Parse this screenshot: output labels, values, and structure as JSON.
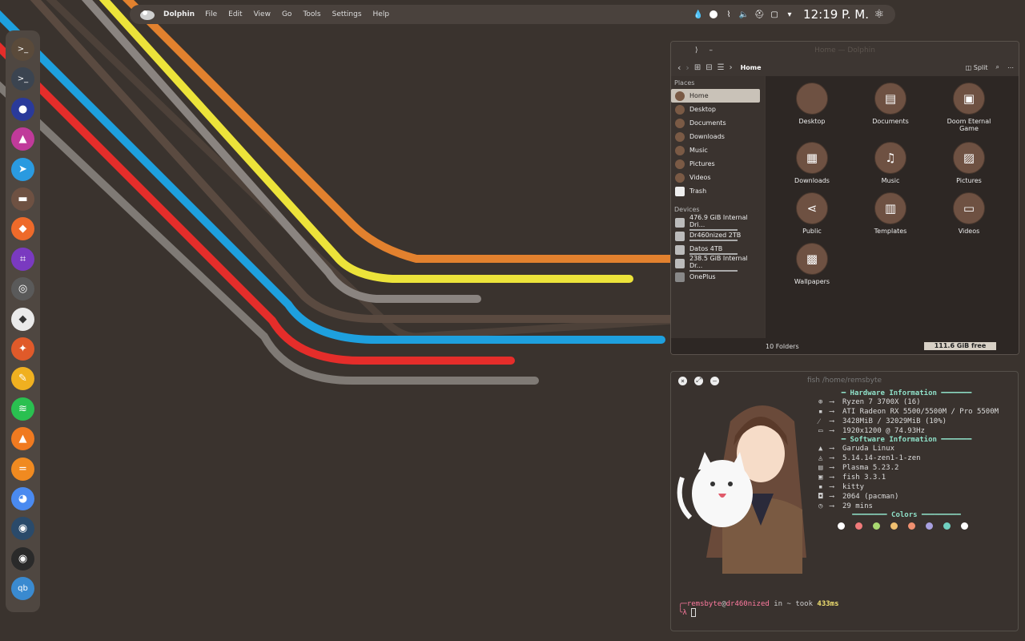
{
  "topbar": {
    "app_name": "Dolphin",
    "menu": [
      "File",
      "Edit",
      "View",
      "Go",
      "Tools",
      "Settings",
      "Help"
    ],
    "clock": "12:19 P. M."
  },
  "dock": {
    "apps": [
      {
        "name": "terminal-app",
        "color": "#5a4a3a",
        "glyph": ">_"
      },
      {
        "name": "konsole-app",
        "color": "#3b4450",
        "glyph": ">_"
      },
      {
        "name": "firefox-app",
        "color": "#2a3a9a",
        "glyph": "●"
      },
      {
        "name": "pamac-app",
        "color": "#c03a9a",
        "glyph": "▲"
      },
      {
        "name": "telegram-app",
        "color": "#2a9ae0",
        "glyph": "➤"
      },
      {
        "name": "notes-app",
        "color": "#6e5142",
        "glyph": "▬"
      },
      {
        "name": "store-app",
        "color": "#ee6a2a",
        "glyph": "◆"
      },
      {
        "name": "crop-app",
        "color": "#7a3ac0",
        "glyph": "⌗"
      },
      {
        "name": "steering-app",
        "color": "#5a5a5a",
        "glyph": "◎"
      },
      {
        "name": "inkscape-app",
        "color": "#eaeaea",
        "glyph": "◆"
      },
      {
        "name": "gimp-app",
        "color": "#e05a2a",
        "glyph": "✦"
      },
      {
        "name": "pencil-app",
        "color": "#f0b020",
        "glyph": "✎"
      },
      {
        "name": "spotify-app",
        "color": "#2ac050",
        "glyph": "≋"
      },
      {
        "name": "vlc-app",
        "color": "#f07a20",
        "glyph": "▲"
      },
      {
        "name": "equals-app",
        "color": "#f08a20",
        "glyph": "="
      },
      {
        "name": "discord-app",
        "color": "#4a8af0",
        "glyph": "◕"
      },
      {
        "name": "steam-app",
        "color": "#2a4a6a",
        "glyph": "◉"
      },
      {
        "name": "obs-app",
        "color": "#2a2a2a",
        "glyph": "◉"
      },
      {
        "name": "qbittorrent-app",
        "color": "#3a8ad0",
        "glyph": "qb"
      }
    ]
  },
  "dolphin": {
    "title": "Home — Dolphin",
    "breadcrumb": "Home",
    "split_label": "Split",
    "places_title": "Places",
    "places": [
      "Home",
      "Desktop",
      "Documents",
      "Downloads",
      "Music",
      "Pictures",
      "Videos",
      "Trash"
    ],
    "devices_title": "Devices",
    "devices": [
      "476.9 GiB Internal Dri...",
      "Dr460nized 2TB",
      "Datos 4TB",
      "238.5 GiB Internal Dr...",
      "OnePlus"
    ],
    "files": [
      {
        "name": "Desktop",
        "glyph": ""
      },
      {
        "name": "Documents",
        "glyph": "▤"
      },
      {
        "name": "Doom Eternal Game",
        "glyph": "▣"
      },
      {
        "name": "Downloads",
        "glyph": "▦"
      },
      {
        "name": "Music",
        "glyph": "♫"
      },
      {
        "name": "Pictures",
        "glyph": "▨"
      },
      {
        "name": "Public",
        "glyph": "⋖"
      },
      {
        "name": "Templates",
        "glyph": "▥"
      },
      {
        "name": "Videos",
        "glyph": "▭"
      },
      {
        "name": "Wallpapers",
        "glyph": "▩"
      }
    ],
    "status_folders": "10 Folders",
    "status_free": "111.6 GiB free"
  },
  "terminal": {
    "title": "fish /home/remsbyte",
    "hw_title": "Hardware Information",
    "hw": [
      "Ryzen 7 3700X (16)",
      "ATI Radeon RX 5500/5500M / Pro 5500M",
      "3428MiB / 32029MiB (10%)",
      "1920x1200 @ 74.93Hz"
    ],
    "sw_title": "Software Information",
    "sw": [
      "Garuda Linux",
      "5.14.14-zen1-1-zen",
      "Plasma 5.23.2",
      "fish 3.3.1",
      "kitty",
      "2064 (pacman)",
      "29 mins"
    ],
    "colors_title": "Colors",
    "colors": [
      "#ffffff",
      "#f07a7a",
      "#a8d870",
      "#f0c070",
      "#f09070",
      "#a8a0e0",
      "#70d0c0",
      "#ffffff"
    ],
    "prompt_user": "remsbyte",
    "prompt_at": "@",
    "prompt_host": "dr460nized",
    "prompt_rest": " in ~ took ",
    "prompt_took": "433ms"
  }
}
